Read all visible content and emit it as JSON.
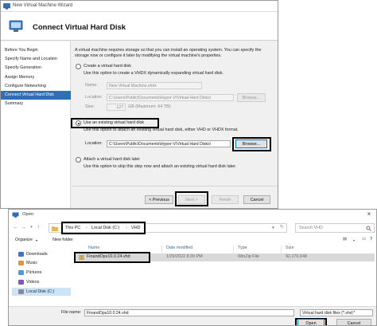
{
  "wizard": {
    "title": "New Virtual Machine Wizard",
    "heading": "Connect Virtual Hard Disk",
    "nav": [
      {
        "label": "Before You Begin",
        "active": false
      },
      {
        "label": "Specify Name and Location",
        "active": false
      },
      {
        "label": "Specify Generation",
        "active": false
      },
      {
        "label": "Assign Memory",
        "active": false
      },
      {
        "label": "Configure Networking",
        "active": false
      },
      {
        "label": "Connect Virtual Hard Disk",
        "active": true
      },
      {
        "label": "Summary",
        "active": false
      }
    ],
    "intro_line1": "A virtual machine requires storage so that you can install an operating system. You can specify the",
    "intro_line2": "storage now or configure it later by modifying the virtual machine's properties.",
    "create_option": {
      "label": "Create a virtual hard disk",
      "desc": "Use this option to create a VHDX dynamically expanding virtual hard disk.",
      "name_label": "Name:",
      "name_value": "New Virtual Machine.vhdx",
      "location_label": "Location:",
      "location_value": "C:\\Users\\Public\\Documents\\Hyper-V\\Virtual Hard Disks\\",
      "browse_label": "Browse...",
      "size_label": "Size:",
      "size_value": "127",
      "size_unit": "GB (Maximum: 64 TB)"
    },
    "existing_option": {
      "label": "Use an existing virtual hard disk",
      "desc": "Use this option to attach an existing virtual hard disk, either VHD or VHDX format.",
      "location_label": "Location:",
      "location_value": "C:\\Users\\Public\\Documents\\Hyper-V\\Virtual Hard Disks\\",
      "browse_label": "Browse..."
    },
    "later_option": {
      "label": "Attach a virtual hard disk later",
      "desc": "Use this option to skip this step now and attach an existing virtual hard disk later."
    },
    "buttons": {
      "previous": "< Previous",
      "next": "Next >",
      "finish": "Finish",
      "cancel": "Cancel"
    }
  },
  "open_dialog": {
    "title": "Open",
    "close_glyph": "×",
    "breadcrumb": [
      "This PC",
      "Local Disk (C:)",
      "VHD"
    ],
    "search_placeholder": "Search VHD",
    "organize_label": "Organize",
    "new_folder_label": "New folder",
    "tree": [
      {
        "label": "Downloads",
        "icon": "download-icon",
        "color": "#3b78c4",
        "selected": false
      },
      {
        "label": "Music",
        "icon": "music-icon",
        "color": "#e0982f",
        "selected": false
      },
      {
        "label": "Pictures",
        "icon": "pictures-icon",
        "color": "#4c9bd6",
        "selected": false
      },
      {
        "label": "Videos",
        "icon": "videos-icon",
        "color": "#7e57c2",
        "selected": false
      },
      {
        "label": "Local Disk (C:)",
        "icon": "drive-icon",
        "color": "#8a8a8a",
        "selected": true
      }
    ],
    "columns": {
      "name": "Name",
      "date": "Date modified",
      "type": "Type",
      "size": "Size"
    },
    "files": [
      {
        "name": "FinandOps10.0.24.vhd",
        "date": "1/29/2022 8:39 PM",
        "type": "WinZip File",
        "size": "92,276,648"
      }
    ],
    "file_name_label": "File name:",
    "file_name_value": "FinandOps10.0.24.vhd",
    "file_type_value": "Virtual hard disk files  (*.vhd;*",
    "open_label": "Open",
    "cancel_label": "Cancel"
  },
  "colors": {
    "accent": "#2f6fb5",
    "highlight_box": "#000000",
    "folder": "#e8b94a"
  }
}
